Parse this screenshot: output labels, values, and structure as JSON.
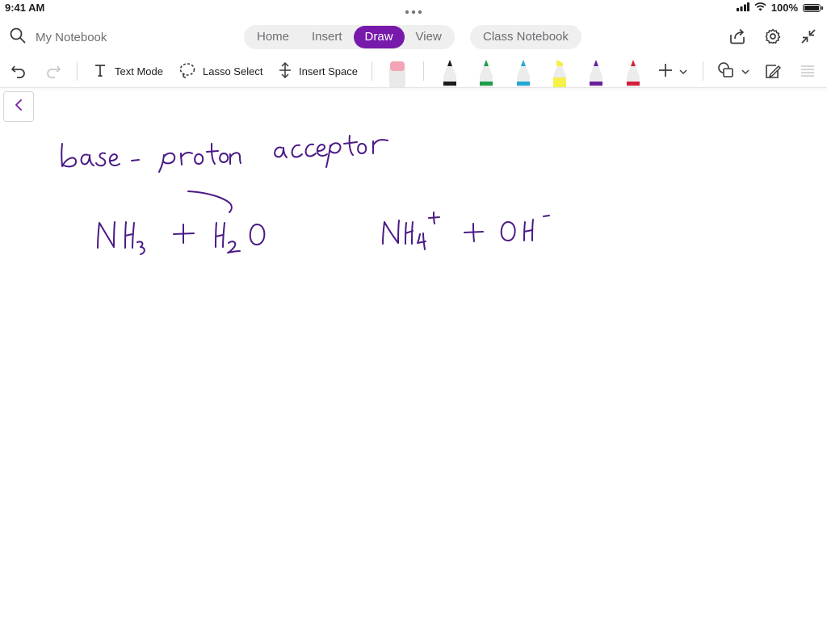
{
  "status": {
    "time": "9:41 AM",
    "battery": "100%",
    "battery_level": 1.0
  },
  "header": {
    "search_icon": "search-icon",
    "notebook_title": "My Notebook",
    "tabs": [
      {
        "label": "Home",
        "active": false
      },
      {
        "label": "Insert",
        "active": false
      },
      {
        "label": "Draw",
        "active": true
      },
      {
        "label": "View",
        "active": false
      }
    ],
    "class_notebook": "Class Notebook",
    "actions": [
      "share-icon",
      "gear-icon",
      "collapse-icon"
    ]
  },
  "toolbar": {
    "text_mode": "Text Mode",
    "lasso_select": "Lasso Select",
    "insert_space": "Insert Space",
    "pens": [
      {
        "name": "black-pen",
        "color": "#1c1c1e"
      },
      {
        "name": "green-pen",
        "color": "#1e9e4a"
      },
      {
        "name": "cyan-pen",
        "color": "#1fa9d6"
      },
      {
        "name": "yellow-highlighter",
        "color": "#f5f04a"
      },
      {
        "name": "purple-pen",
        "color": "#6b1f9e"
      },
      {
        "name": "red-pen",
        "color": "#d6203a"
      }
    ],
    "eraser_color": "#f3a5b5"
  },
  "accent_color": "#7719aa",
  "ink_color": "#4b1a86"
}
